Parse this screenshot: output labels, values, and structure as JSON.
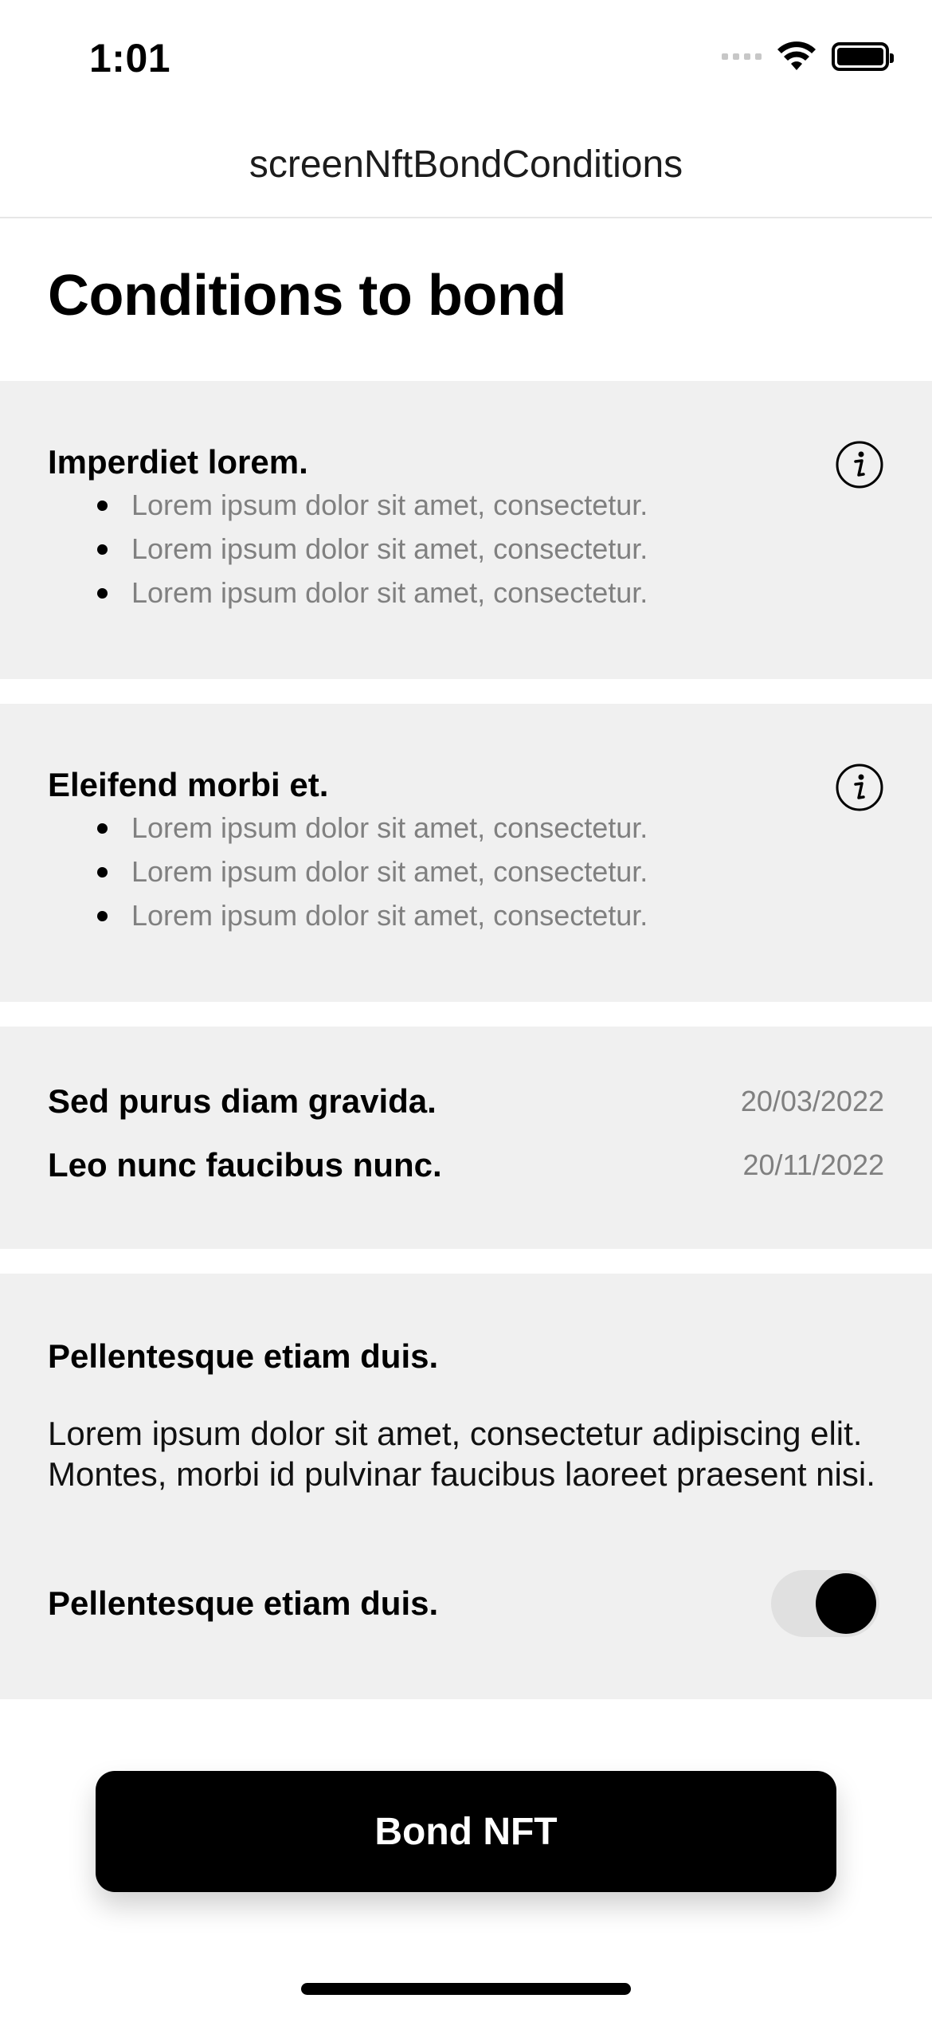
{
  "status_bar": {
    "time": "1:01",
    "icons": [
      "cellular-signal-icon",
      "wifi-icon",
      "battery-icon"
    ]
  },
  "nav": {
    "title": "screenNftBondConditions"
  },
  "page": {
    "title": "Conditions to bond"
  },
  "sections": [
    {
      "heading": "Imperdiet lorem.",
      "icon": "info-icon",
      "bullets": [
        "Lorem ipsum dolor sit amet, consectetur.",
        "Lorem ipsum dolor sit amet, consectetur.",
        "Lorem ipsum dolor sit amet, consectetur."
      ]
    },
    {
      "heading": "Eleifend morbi et.",
      "icon": "info-icon",
      "bullets": [
        "Lorem ipsum dolor sit amet, consectetur.",
        "Lorem ipsum dolor sit amet, consectetur.",
        "Lorem ipsum dolor sit amet, consectetur."
      ]
    }
  ],
  "dates": [
    {
      "label": "Sed purus diam gravida.",
      "value": "20/03/2022"
    },
    {
      "label": "Leo nunc faucibus nunc.",
      "value": "20/11/2022"
    }
  ],
  "agreement": {
    "heading": "Pellentesque etiam duis.",
    "body": "Lorem ipsum dolor sit amet, consectetur adipiscing elit. Montes, morbi id pulvinar faucibus laoreet praesent nisi.",
    "toggle_label": "Pellentesque etiam duis.",
    "toggle_on": true
  },
  "actions": {
    "bond_label": "Bond NFT"
  },
  "colors": {
    "card_background": "#f0f0f0",
    "secondary_text": "#808080",
    "primary": "#000000"
  }
}
